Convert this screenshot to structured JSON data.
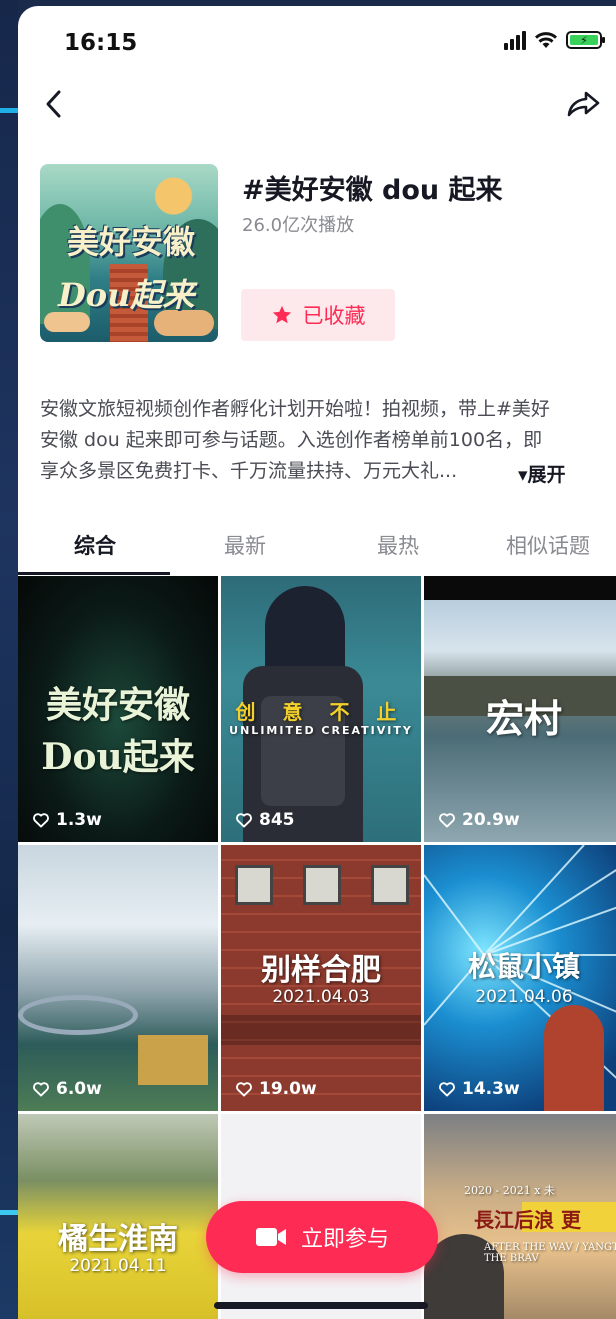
{
  "status_bar": {
    "time": "16:15",
    "battery_color": "#3ad15a"
  },
  "nav": {
    "back_icon": "chevron-left-icon",
    "share_icon": "share-arrow-icon"
  },
  "topic": {
    "title": "#美好安徽 dou 起来",
    "play_count": "26.0亿次播放",
    "favorite_label": "已收藏",
    "cover_title_line1": "美好安徽",
    "cover_title_line2": "Dou起来"
  },
  "description": {
    "lines": [
      "安徽文旅短视频创作者孵化计划开始啦！拍视频，带上#美好",
      "安徽 dou 起来即可参与话题。入选创作者榜单前100名，即",
      "享众多景区免费打卡、千万流量扶持、万元大礼..."
    ],
    "expand_label": "▾展开"
  },
  "tabs": [
    "综合",
    "最新",
    "最热",
    "相似话题"
  ],
  "videos": [
    {
      "likes": "1.3w",
      "overlay": "美好安徽 Dou起来",
      "date": ""
    },
    {
      "likes": "845",
      "overlay": "创 意 不 止",
      "sub": "UNLIMITED CREATIVITY",
      "date": ""
    },
    {
      "likes": "20.9w",
      "overlay": "宏村",
      "date": ""
    },
    {
      "likes": "6.0w",
      "overlay": "",
      "date": ""
    },
    {
      "likes": "19.0w",
      "overlay": "别样合肥",
      "date": "2021.04.03"
    },
    {
      "likes": "14.3w",
      "overlay": "松鼠小镇",
      "date": "2021.04.06"
    },
    {
      "likes": "",
      "overlay": "橘生淮南",
      "date": "2021.04.11"
    },
    {
      "likes": "",
      "overlay": "",
      "date": ""
    },
    {
      "likes": "",
      "overlay": "長江后浪 更",
      "date": "2020 - 2021 x 未",
      "sub": "AFTER THE WAV / YANGTZE / ON THE BRAV"
    }
  ],
  "join_button": {
    "label": "立即参与",
    "icon": "video-camera-icon"
  },
  "colors": {
    "accent": "#fe2c55",
    "text_primary": "#161823",
    "text_secondary": "#8a8b91"
  }
}
